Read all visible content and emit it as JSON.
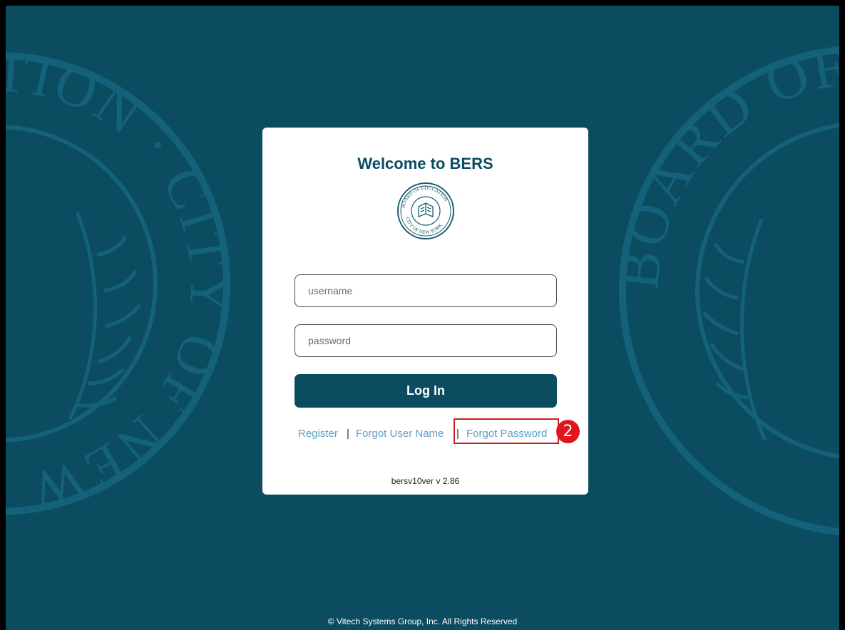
{
  "app": {
    "welcome_title": "Welcome to BERS",
    "seal": {
      "text_top": "BOARD OF EDUCATION",
      "text_bottom": "CITY OF NEW YORK"
    }
  },
  "background": {
    "seal_left_text": "EDUCATION · CITY OF NEW YORK",
    "seal_right_text": "BOARD OF · CITY OF NEW YORK"
  },
  "form": {
    "username_placeholder": "username",
    "password_placeholder": "password",
    "login_label": "Log In"
  },
  "links": {
    "register": "Register",
    "separator": "|",
    "forgot_user": "Forgot User Name",
    "forgot_password": "Forgot Password"
  },
  "annotation": {
    "step_number": "2",
    "highlight_color": "#d01c1c",
    "badge_color": "#e0161c"
  },
  "version": "bersv10ver v 2.86",
  "footer": "© Vitech Systems Group, Inc. All Rights Reserved",
  "colors": {
    "brand": "#0b4c61",
    "link": "#5f9fc7"
  }
}
